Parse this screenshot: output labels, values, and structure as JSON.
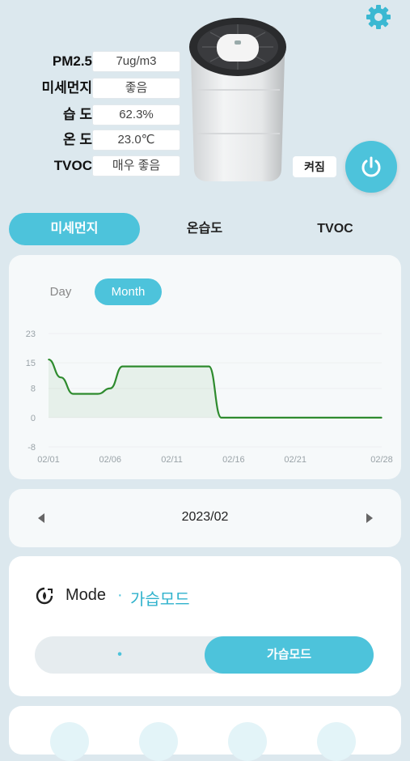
{
  "readings": [
    {
      "label": "PM2.5",
      "value": "7ug/m3"
    },
    {
      "label": "미세먼지",
      "value": "좋음"
    },
    {
      "label": "습 도",
      "value": "62.3%"
    },
    {
      "label": "온 도",
      "value": "23.0℃"
    },
    {
      "label": "TVOC",
      "value": "매우 좋음"
    }
  ],
  "power": {
    "state_label": "켜짐"
  },
  "tabs": [
    {
      "label": "미세먼지",
      "active": true
    },
    {
      "label": "온습도",
      "active": false
    },
    {
      "label": "TVOC",
      "active": false
    }
  ],
  "range_toggle": [
    {
      "label": "Day",
      "active": false
    },
    {
      "label": "Month",
      "active": true
    }
  ],
  "chart_data": {
    "type": "line",
    "x_tick_labels": [
      "02/01",
      "02/06",
      "02/11",
      "02/16",
      "02/21",
      "02/28"
    ],
    "y_tick_labels": [
      "23",
      "15",
      "8",
      "0",
      "-8"
    ],
    "ylim": [
      -8,
      23
    ],
    "grid": true,
    "line_color": "#2e8b2e",
    "x": [
      1,
      2,
      3,
      4,
      5,
      6,
      7,
      8,
      9,
      10,
      11,
      12,
      13,
      14,
      15,
      16,
      17,
      18,
      19,
      20,
      21,
      22,
      23,
      24,
      25,
      26,
      27,
      28
    ],
    "series": [
      {
        "values": [
          15.9,
          11,
          6.5,
          6.5,
          6.5,
          8,
          14,
          14,
          14,
          14,
          14,
          14,
          14,
          14,
          0,
          0,
          0,
          0,
          0,
          0,
          0,
          0,
          0,
          0,
          0,
          0,
          0,
          0
        ]
      }
    ]
  },
  "date_nav": {
    "label": "2023/02"
  },
  "mode": {
    "title": "Mode",
    "separator": "·",
    "value": "가습모드"
  },
  "mode_switch": {
    "left_label": "•",
    "right_label": "가습모드"
  },
  "colors": {
    "accent": "#4dc3db",
    "background": "#dce8ee",
    "line": "#2e8b2e"
  }
}
